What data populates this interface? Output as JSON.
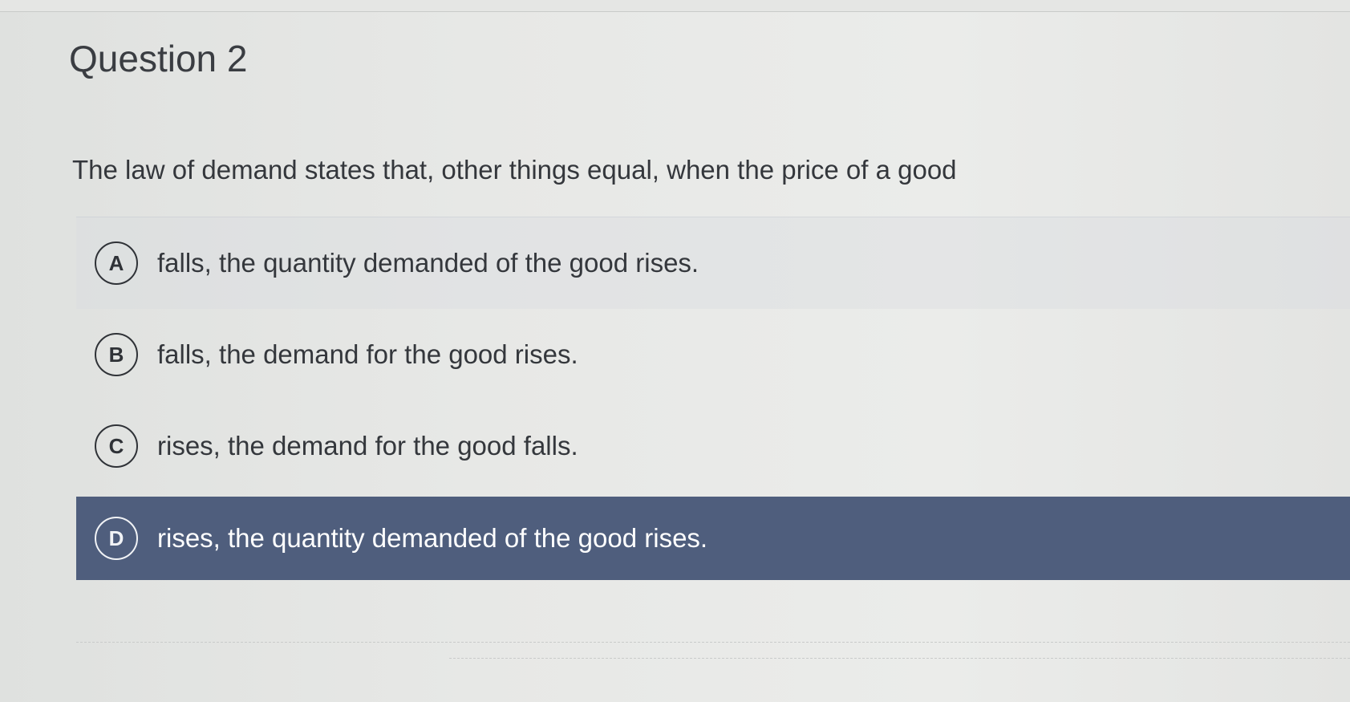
{
  "question": {
    "title": "Question 2",
    "stem": "The law of demand states that, other things equal, when the price of a good"
  },
  "options": [
    {
      "letter": "A",
      "text": "falls, the quantity demanded of the good rises.",
      "selected": false
    },
    {
      "letter": "B",
      "text": "falls, the demand for the good rises.",
      "selected": false
    },
    {
      "letter": "C",
      "text": "rises, the demand for the good falls.",
      "selected": false
    },
    {
      "letter": "D",
      "text": "rises, the quantity demanded of the good rises.",
      "selected": true
    }
  ],
  "colors": {
    "selected_background": "#4f5e7d",
    "selected_text": "#ffffff",
    "body_text": "#34373c"
  }
}
